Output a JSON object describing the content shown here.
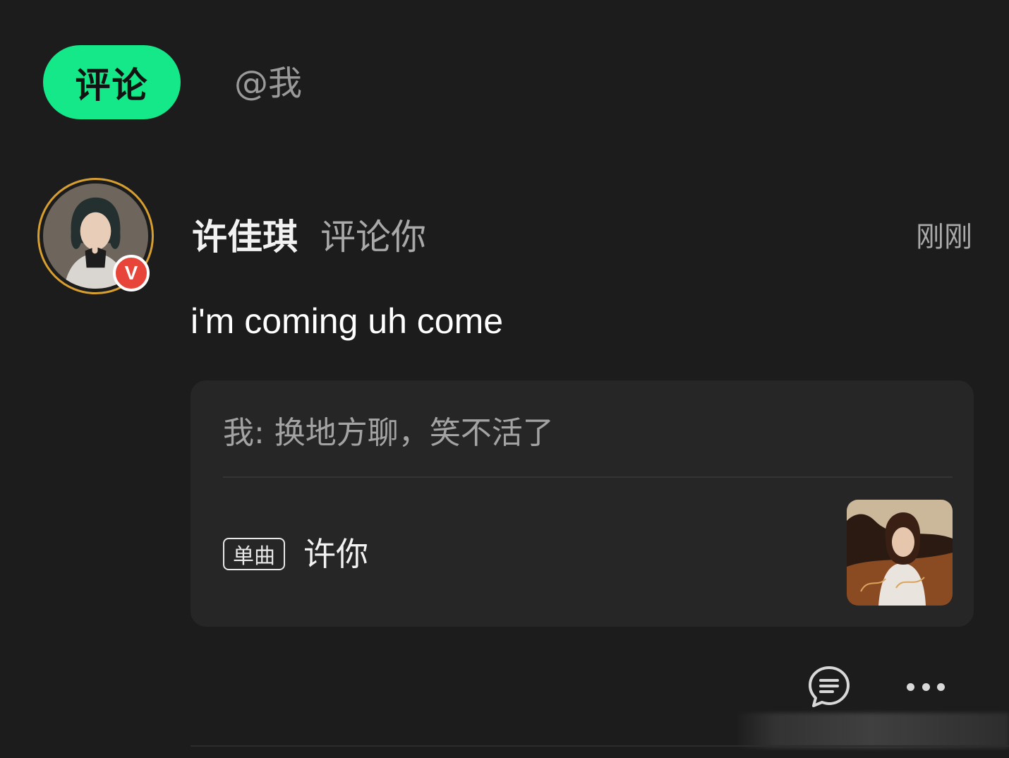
{
  "tabs": [
    {
      "label": "评论",
      "active": true
    },
    {
      "label": "@我",
      "active": false
    }
  ],
  "notification": {
    "user_name": "许佳琪",
    "action": "评论你",
    "timestamp": "刚刚",
    "verified_badge": "V",
    "comment": "i'm coming uh come",
    "quote": {
      "text": "我: 换地方聊，笑不活了"
    },
    "song": {
      "tag": "单曲",
      "title": "许你",
      "cover_icon": "album-cover-image"
    }
  },
  "actions": {
    "reply_icon": "comment-bubble-icon",
    "more_icon": "more-dots-icon"
  },
  "colors": {
    "accent": "#14e889",
    "background": "#1c1c1c",
    "card": "#262626",
    "badge": "#e8453a",
    "avatar_ring": "#d79e30"
  }
}
